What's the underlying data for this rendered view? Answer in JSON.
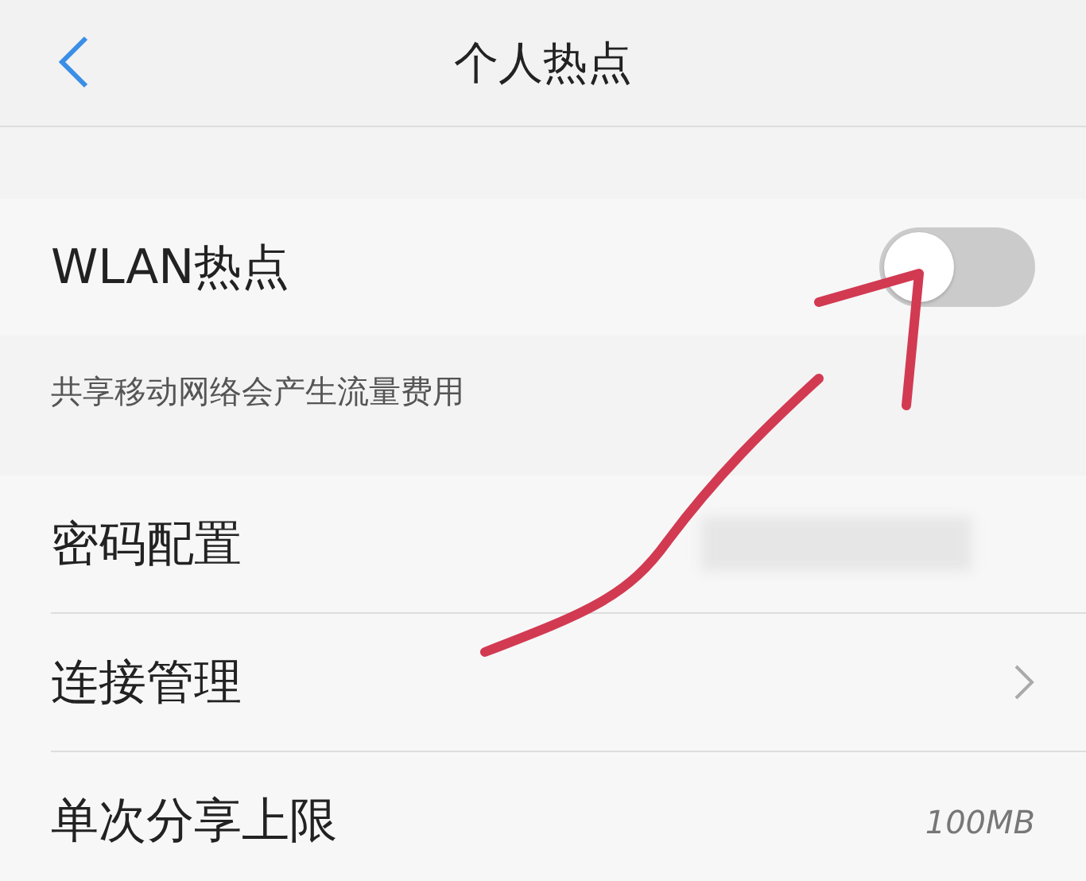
{
  "header": {
    "title": "个人热点"
  },
  "hotspot": {
    "label": "WLAN热点",
    "on": false,
    "note": "共享移动网络会产生流量费用"
  },
  "rows": [
    {
      "label": "密码配置",
      "kind": "hidden"
    },
    {
      "label": "连接管理",
      "kind": "link"
    },
    {
      "label": "单次分享上限",
      "kind": "value",
      "value": "100MB"
    }
  ]
}
